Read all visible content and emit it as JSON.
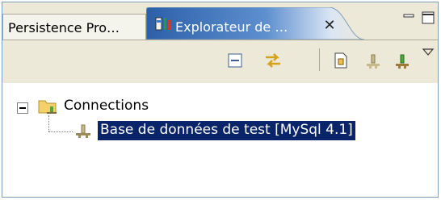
{
  "tabs": [
    {
      "label": "Persistence Pro…",
      "active": false
    },
    {
      "label": "Explorateur de …",
      "active": true
    }
  ],
  "tab_close_glyph": "✕",
  "window_controls": [
    "minimize-icon",
    "maximize-icon"
  ],
  "toolbar": {
    "buttons": [
      "collapse-all-icon",
      "link-with-editor-icon",
      "new-connection-icon",
      "connect-icon",
      "disconnect-icon"
    ],
    "view_menu": "chevron-down-icon"
  },
  "tree": {
    "root": {
      "label": "Connections",
      "expanded": true,
      "icon": "folder-database-icon"
    },
    "children": [
      {
        "label": "Base de données de test [MySql 4.1]",
        "selected": true,
        "icon": "database-icon"
      }
    ]
  },
  "colors": {
    "selection": "#0a246a",
    "active_tab": "#3a6ea5",
    "chrome": "#ece9d8",
    "border": "#7f9db9"
  }
}
